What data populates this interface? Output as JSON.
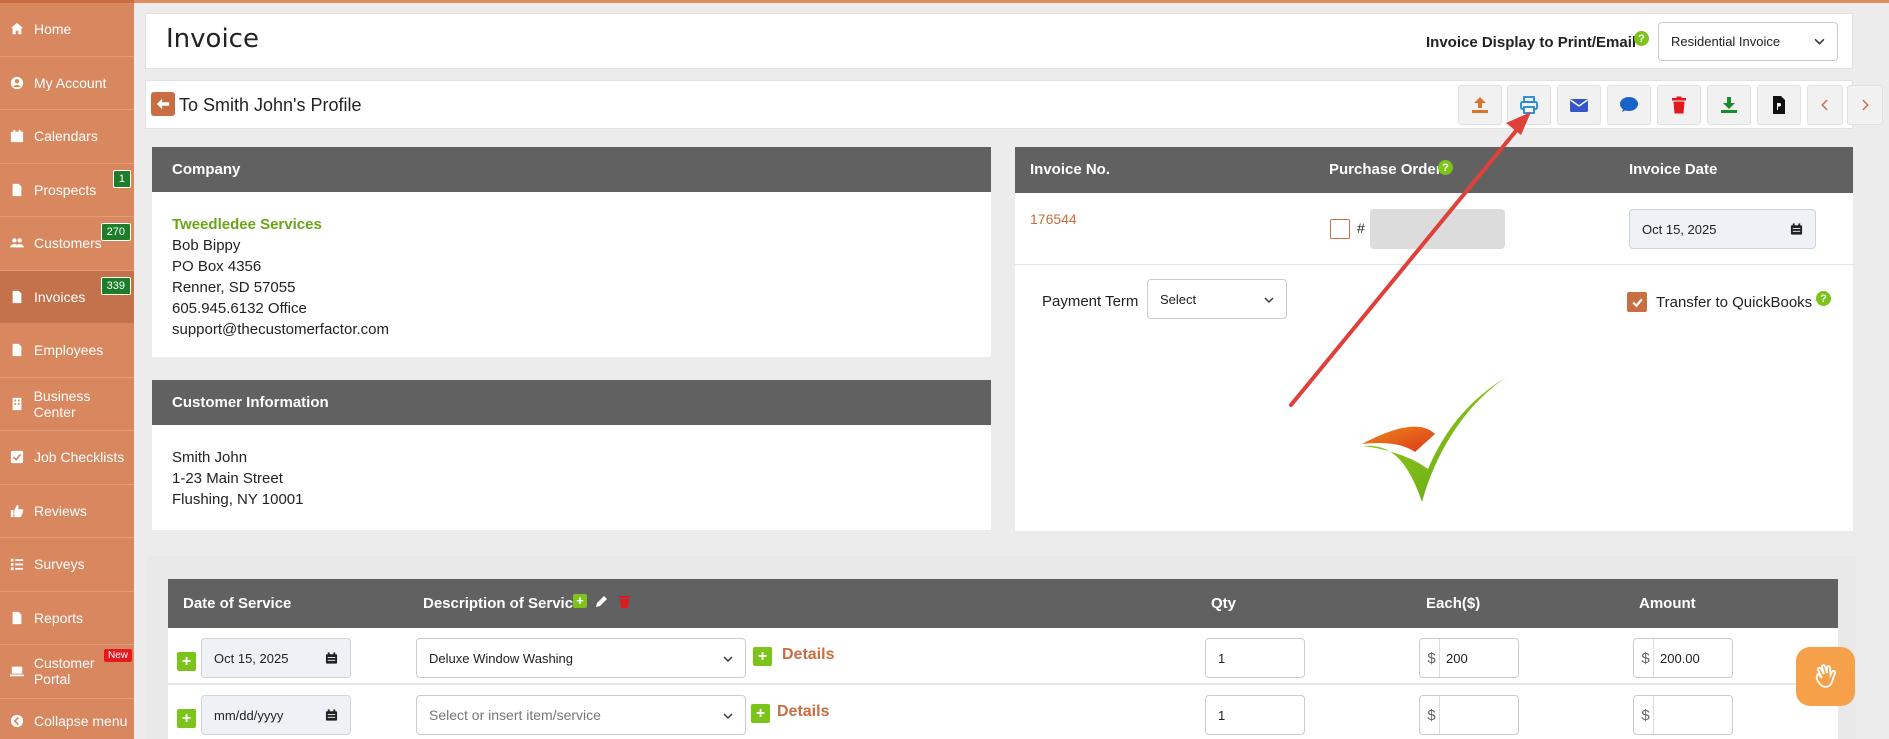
{
  "sidebar": {
    "items": [
      {
        "label": "Home",
        "icon": "home-icon"
      },
      {
        "label": "My Account",
        "icon": "user-circle-icon"
      },
      {
        "label": "Calendars",
        "icon": "calendar-icon"
      },
      {
        "label": "Prospects",
        "icon": "file-icon",
        "badge": "1"
      },
      {
        "label": "Customers",
        "icon": "users-icon",
        "badge": "270"
      },
      {
        "label": "Invoices",
        "icon": "file-icon",
        "badge": "339"
      },
      {
        "label": "Employees",
        "icon": "file-icon"
      },
      {
        "label": "Business Center",
        "icon": "building-icon"
      },
      {
        "label": "Job Checklists",
        "icon": "checkbox-icon"
      },
      {
        "label": "Reviews",
        "icon": "thumbs-up-icon"
      },
      {
        "label": "Surveys",
        "icon": "list-icon"
      },
      {
        "label": "Reports",
        "icon": "file-icon"
      },
      {
        "label": "Customer Portal",
        "icon": "laptop-icon",
        "badge_new": "New"
      }
    ],
    "collapse_label": "Collapse menu"
  },
  "header": {
    "title": "Invoice",
    "display_label": "Invoice Display to Print/Email",
    "display_value": "Residential Invoice",
    "help": "?"
  },
  "toolbar": {
    "back_label": "To Smith John's Profile",
    "buttons": [
      "upload-icon",
      "print-icon",
      "envelope-icon",
      "comment-icon",
      "trash-icon",
      "download-icon",
      "pdf-icon",
      "prev-icon",
      "next-icon"
    ]
  },
  "company": {
    "heading": "Company",
    "name": "Tweedledee Services",
    "contact": "Bob Bippy",
    "address1": "PO Box 4356",
    "address2": "Renner, SD 57055",
    "phone": "605.945.6132 Office",
    "email": "support@thecustomerfactor.com"
  },
  "customer": {
    "heading": "Customer Information",
    "name": "Smith John",
    "address1": "1-23 Main Street",
    "address2": "Flushing, NY 10001"
  },
  "invoice": {
    "no_label": "Invoice No.",
    "po_label": "Purchase Order",
    "date_label": "Invoice Date",
    "number": "176544",
    "hash": "#",
    "date": "Oct 15, 2025",
    "payment_term_label": "Payment Term",
    "payment_term_value": "Select",
    "quickbooks_label": "Transfer to QuickBooks"
  },
  "items": {
    "headers": {
      "date": "Date of Service",
      "description": "Description of Service",
      "qty": "Qty",
      "each": "Each($)",
      "amount": "Amount"
    },
    "details_label": "Details",
    "currency": "$",
    "rows": [
      {
        "date": "Oct 15, 2025",
        "service": "Deluxe Window Washing",
        "qty": "1",
        "each": "200",
        "amount": "200.00"
      },
      {
        "date": "mm/dd/yyyy",
        "service": "Select or insert item/service",
        "qty": "1",
        "each": "",
        "amount": ""
      }
    ]
  },
  "colors": {
    "sidebar": "#d9875f",
    "accent": "#c96d43",
    "green": "#7cc31a",
    "header_bar": "#616161"
  }
}
